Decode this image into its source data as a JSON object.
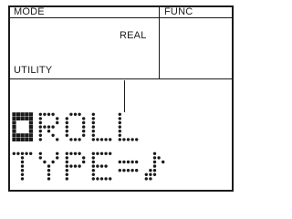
{
  "header": {
    "mode_label": "MODE",
    "func_label": "FUNC"
  },
  "status": {
    "mode_value": "REAL",
    "page_label": "UTILITY"
  },
  "lcd": {
    "line1": "▮ROLL",
    "line2": "TYPE=♪"
  },
  "colors": {
    "ink": "#1a1a1a",
    "background": "#ffffff"
  }
}
